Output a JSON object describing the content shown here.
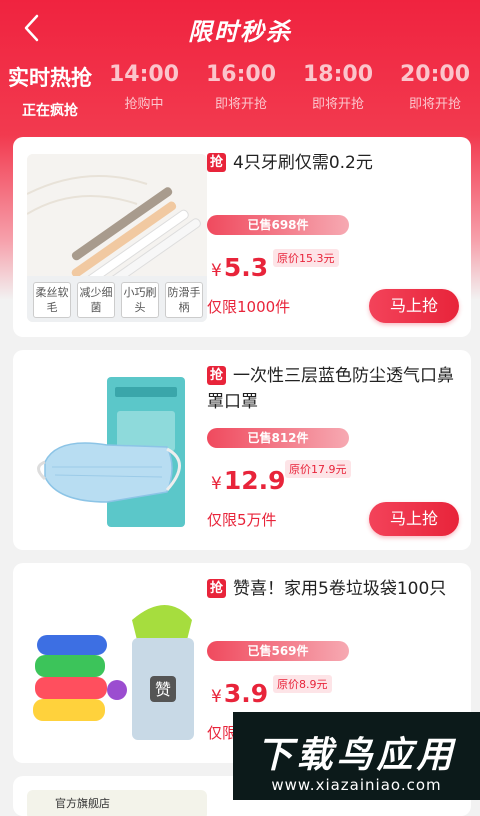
{
  "header": {
    "title": "限时秒杀",
    "now_title": "实时热抢",
    "now_status": "正在疯抢",
    "slots": [
      {
        "time": "14:00",
        "status": "抢购中"
      },
      {
        "time": "16:00",
        "status": "即将开抢"
      },
      {
        "time": "18:00",
        "status": "即将开抢"
      },
      {
        "time": "20:00",
        "status": "即将开抢"
      }
    ]
  },
  "products": [
    {
      "tag": "抢",
      "title": "4只牙刷仅需0.2元",
      "sold": "已售698件",
      "yen": "¥",
      "price": "5.3",
      "original": "原价15.3元",
      "limit": "仅限1000件",
      "buy_label": "马上抢",
      "image_labels": [
        "柔丝软毛",
        "减少细菌",
        "小巧刷头",
        "防滑手柄"
      ]
    },
    {
      "tag": "抢",
      "title": "一次性三层蓝色防尘透气口鼻罩口罩",
      "sold": "已售812件",
      "yen": "¥",
      "price": "12.9",
      "original": "原价17.9元",
      "limit": "仅限5万件",
      "buy_label": "马上抢"
    },
    {
      "tag": "抢",
      "title": "赞喜！家用5卷垃圾袋100只",
      "sold": "已售569件",
      "yen": "¥",
      "price": "3.9",
      "original": "原价8.9元",
      "limit": "仅限",
      "bin_label": "赞"
    },
    {
      "partial_label": "官方旗舰店"
    }
  ],
  "watermark": {
    "name": "下载鸟应用",
    "url": "www.xiazainiao.com"
  },
  "colors": {
    "brand_red": "#e8243a",
    "tag_bg": "#fde4e7"
  }
}
